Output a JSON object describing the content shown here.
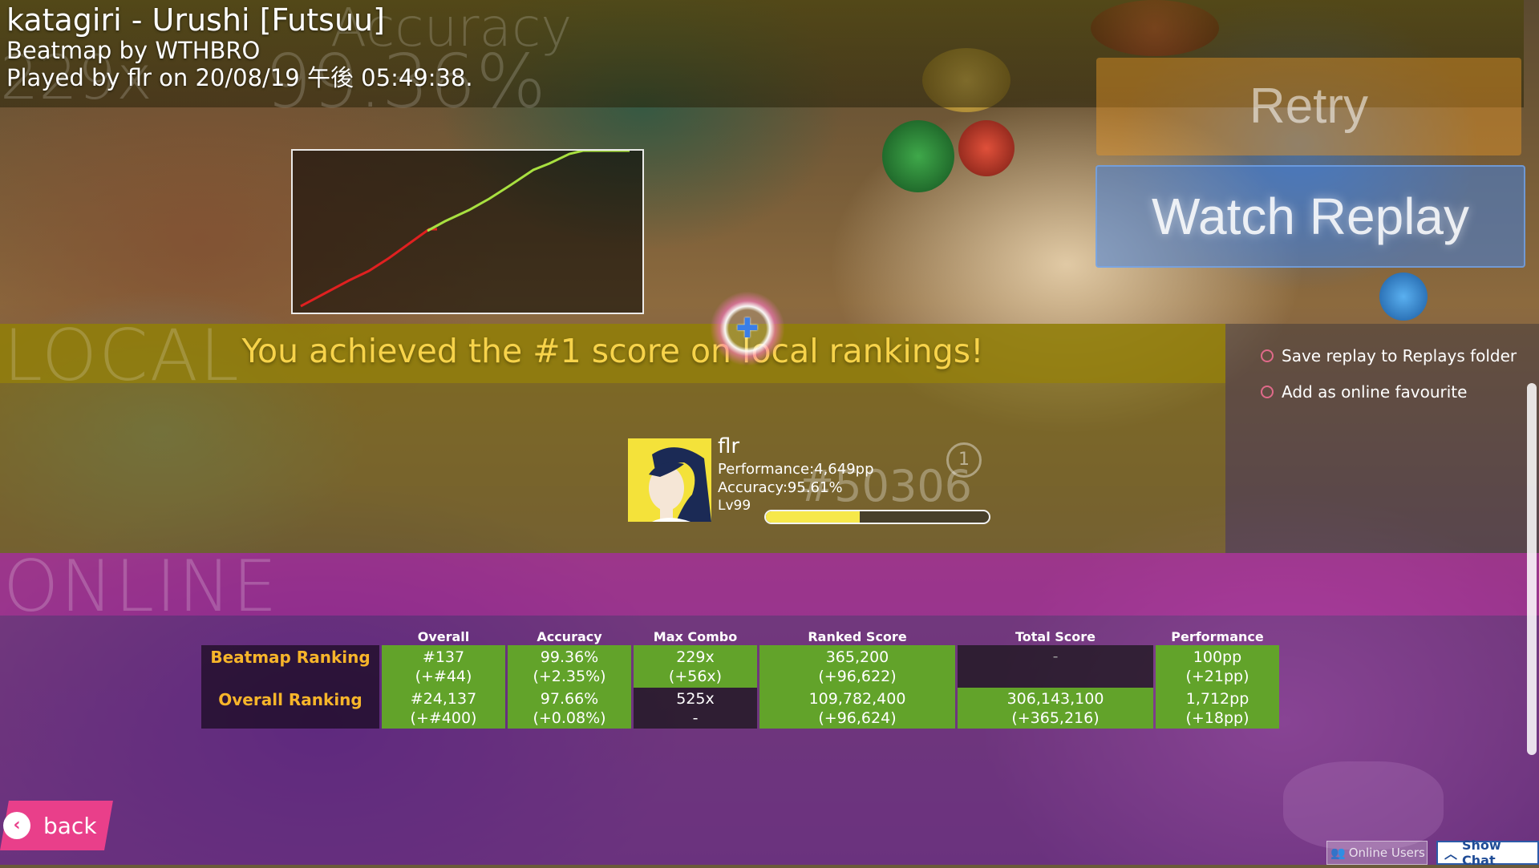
{
  "header": {
    "title": "katagiri - Urushi [Futsuu]",
    "mapper_line": "Beatmap by WTHBRO",
    "played_line": "Played by flr on 20/08/19 午後 05:49:38.",
    "ghost_combo": "229x",
    "ghost_accuracy_label": "Accuracy",
    "ghost_accuracy": "99.36%"
  },
  "buttons": {
    "retry": "Retry",
    "watch_replay": "Watch Replay",
    "back": "back",
    "online_users": "Online Users",
    "show_chat": "Show Chat"
  },
  "local": {
    "section_label": "LOCAL",
    "message": "You achieved the #1 score on local rankings!"
  },
  "options": {
    "save_replay": "Save replay to Replays folder",
    "add_favourite": "Add as online favourite"
  },
  "player": {
    "name": "flr",
    "performance": "Performance:4,649pp",
    "accuracy": "Accuracy:95.61%",
    "level": "Lv99",
    "rank_ghost": "#50306",
    "rank_circle": "1",
    "level_progress": 0.42
  },
  "online": {
    "section_label": "ONLINE",
    "columns": [
      "Overall",
      "Accuracy",
      "Max Combo",
      "Ranked Score",
      "Total Score",
      "Performance"
    ],
    "rows": [
      {
        "label": "Beatmap Ranking",
        "cells": [
          {
            "main": "#137",
            "delta": "(+#44)"
          },
          {
            "main": "99.36%",
            "delta": "(+2.35%)"
          },
          {
            "main": "229x",
            "delta": "(+56x)"
          },
          {
            "main": "365,200",
            "delta": "(+96,622)"
          },
          {
            "main": "-",
            "delta": ""
          },
          {
            "main": "100pp",
            "delta": "(+21pp)"
          }
        ]
      },
      {
        "label": "Overall Ranking",
        "cells": [
          {
            "main": "#24,137",
            "delta": "(+#400)"
          },
          {
            "main": "97.66%",
            "delta": "(+0.08%)"
          },
          {
            "main": "525x",
            "delta": "-"
          },
          {
            "main": "109,782,400",
            "delta": "(+96,624)"
          },
          {
            "main": "306,143,100",
            "delta": "(+365,216)"
          },
          {
            "main": "1,712pp",
            "delta": "(+18pp)"
          }
        ]
      }
    ]
  },
  "colors": {
    "accent_pink": "#e93f8a",
    "cell_green": "#62a32a",
    "label_orange": "#f7b52a",
    "local_message": "#f7d34a",
    "graph_low": "#e02020",
    "graph_high": "#a8e040"
  },
  "icons": {
    "back": "chevron-left-icon",
    "online_users": "users-icon",
    "show_chat": "chevron-up-icon",
    "cursor": "plus-icon"
  }
}
